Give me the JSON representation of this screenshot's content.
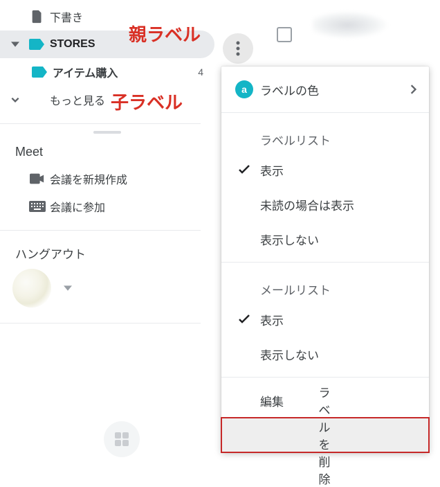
{
  "sidebar": {
    "drafts": {
      "label": "下書き"
    },
    "parent": {
      "label": "STORES"
    },
    "child": {
      "label": "アイテム購入",
      "count": "4"
    },
    "more": {
      "label": "もっと見る"
    },
    "meet": {
      "title": "Meet",
      "new": "会議を新規作成",
      "join": "会議に参加"
    },
    "hangout": {
      "title": "ハングアウト"
    }
  },
  "annotations": {
    "parent": "親ラベル",
    "child": "子ラベル"
  },
  "menu": {
    "labelColor": "ラベルの色",
    "badge": "a",
    "sectionLabelList": "ラベルリスト",
    "show": "表示",
    "showIfUnread": "未読の場合は表示",
    "hide": "表示しない",
    "sectionMailList": "メールリスト",
    "edit": "編集",
    "delete": "ラベルを削除"
  }
}
